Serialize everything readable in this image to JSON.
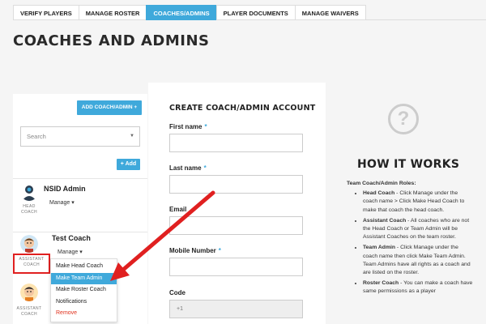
{
  "tabs": [
    {
      "label": "VERIFY PLAYERS"
    },
    {
      "label": "MANAGE ROSTER"
    },
    {
      "label": "COACHES/ADMINS"
    },
    {
      "label": "PLAYER DOCUMENTS"
    },
    {
      "label": "MANAGE WAIVERS"
    }
  ],
  "page_title": "COACHES AND ADMINS",
  "left": {
    "add_coach_label": "ADD COACH/ADMIN +",
    "search_placeholder": "Search",
    "add_label": "+ Add",
    "coaches": [
      {
        "name": "NSID Admin",
        "role_line1": "HEAD",
        "role_line2": "COACH",
        "manage_label": "Manage ▾"
      },
      {
        "name": "Test Coach",
        "role_line1": "ASSISTANT",
        "role_line2": "COACH",
        "manage_label": "Manage ▾"
      },
      {
        "name": "",
        "role_line1": "ASSISTANT",
        "role_line2": "COACH",
        "manage_label": ""
      }
    ],
    "dropdown": [
      {
        "label": "Make Head Coach"
      },
      {
        "label": "Make Team Admin"
      },
      {
        "label": "Make Roster Coach"
      },
      {
        "label": "Notifications"
      },
      {
        "label": "Remove"
      }
    ]
  },
  "form": {
    "title": "CREATE COACH/ADMIN ACCOUNT",
    "fields": [
      {
        "label": "First name",
        "required": "*",
        "value": ""
      },
      {
        "label": "Last name",
        "required": "*",
        "value": ""
      },
      {
        "label": "Email",
        "required": "",
        "value": ""
      },
      {
        "label": "Mobile Number",
        "required": "*",
        "value": ""
      },
      {
        "label": "Code",
        "required": "",
        "value": "+1"
      }
    ]
  },
  "how": {
    "icon": "?",
    "title": "HOW IT WORKS",
    "lead": "Team Coach/Admin Roles:",
    "items": [
      {
        "term": "Head Coach",
        "text": " - Click Manage under the coach name > Click Make Head Coach to make that coach the head coach."
      },
      {
        "term": "Assistant Coach",
        "text": " - All coaches who are not the Head Coach or Team Admin will be Assistant Coaches on the team roster."
      },
      {
        "term": "Team Admin",
        "text": " - Click Manage under the coach name then click Make Team Admin. Team Admins have all rights as a coach and are listed on the roster."
      },
      {
        "term": "Roster Coach",
        "text": " - You can make a coach have same permissions as a player"
      }
    ]
  },
  "colors": {
    "accent": "#3fa9db",
    "annotation_red": "#e02020",
    "remove_red": "#e0321e"
  }
}
